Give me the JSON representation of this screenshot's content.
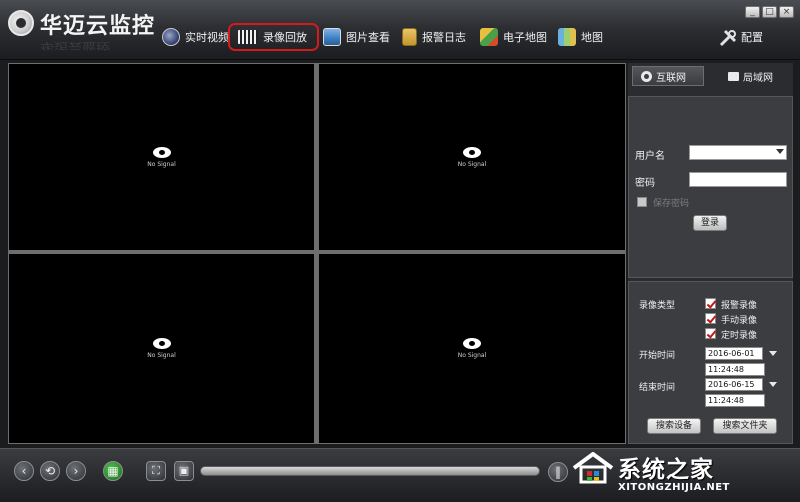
{
  "app": {
    "title": "华迈云监控"
  },
  "nav": {
    "live_video": "实时视频",
    "playback": "录像回放",
    "picture_view": "图片查看",
    "alarm_log": "报警日志",
    "e_map": "电子地图",
    "map": "地图",
    "config": "配置"
  },
  "window_controls": {
    "minimize": "_",
    "maximize": "□",
    "close": "×"
  },
  "video": {
    "no_signal": "No Signal"
  },
  "panel": {
    "tabs": {
      "internet": "互联网",
      "lan": "局域网"
    },
    "login": {
      "username_label": "用户名",
      "username_value": "",
      "password_label": "密码",
      "password_value": "",
      "remember_label": "保存密码",
      "login_button": "登录"
    },
    "search": {
      "record_type_label": "录像类型",
      "types": [
        "报警录像",
        "手动录像",
        "定时录像"
      ],
      "start_label": "开始时间",
      "start_date": "2016-06-01",
      "start_time": "11:24:48",
      "end_label": "结束时间",
      "end_date": "2016-06-15",
      "end_time": "11:24:48",
      "search_device_button": "搜索设备",
      "search_folder_button": "搜索文件夹"
    }
  },
  "playback_controls": {
    "progress": 0
  },
  "watermark": {
    "text": "系统之家",
    "sub": "XITONGZHIJIA.NET"
  },
  "colors": {
    "highlight": "#d41a1a",
    "check": "#c01818",
    "cell_bg": "#000000"
  }
}
